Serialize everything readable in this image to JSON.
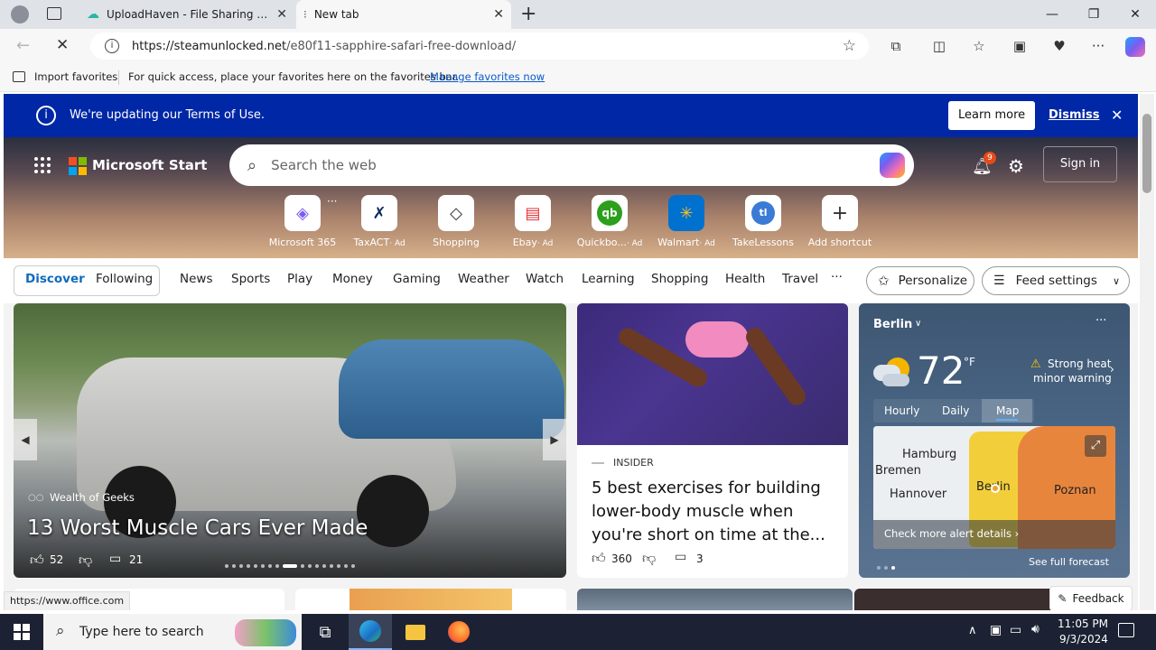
{
  "browser": {
    "tabs": [
      {
        "title": "UploadHaven - File Sharing Made Simple",
        "active": false
      },
      {
        "title": "New tab",
        "active": true
      }
    ],
    "url_domain": "https://steamunlocked.net",
    "url_path": "/e80f11-sapphire-safari-free-download/"
  },
  "favbar": {
    "import_label": "Import favorites",
    "hint": "For quick access, place your favorites here on the favorites bar.",
    "manage_link": "Manage favorites now"
  },
  "banner": {
    "text": "We're updating our Terms of Use.",
    "learn_more": "Learn more",
    "dismiss": "Dismiss"
  },
  "msn": {
    "brand": "Microsoft Start",
    "search_placeholder": "Search the web",
    "notif_count": "9",
    "sign_in": "Sign in",
    "shortcuts": [
      {
        "label": "Microsoft 365",
        "ad": "",
        "icon": "m365-icon",
        "color": "#7b5cf0"
      },
      {
        "label": "TaxACT",
        "ad": "· Ad",
        "icon": "taxact-icon",
        "color": "#0a2a5a"
      },
      {
        "label": "Shopping",
        "ad": "",
        "icon": "tag-icon",
        "color": "#333333"
      },
      {
        "label": "Ebay",
        "ad": "· Ad",
        "icon": "ebay-icon",
        "color": "#e53238"
      },
      {
        "label": "Quickbo...",
        "ad": "· Ad",
        "icon": "quickbooks-icon",
        "color": "#2ca01c"
      },
      {
        "label": "Walmart",
        "ad": "· Ad",
        "icon": "walmart-icon",
        "color": "#0071ce"
      },
      {
        "label": "TakeLessons",
        "ad": "",
        "icon": "takelessons-icon",
        "color": "#3a7bd5"
      },
      {
        "label": "Add shortcut",
        "ad": "",
        "icon": "plus-icon",
        "color": "#333333"
      }
    ]
  },
  "nav": {
    "discover": "Discover",
    "following": "Following",
    "items": [
      "News",
      "Sports",
      "Play",
      "Money",
      "Gaming",
      "Weather",
      "Watch",
      "Learning",
      "Shopping",
      "Health",
      "Travel"
    ],
    "more": "···",
    "personalize": "Personalize",
    "feed_settings": "Feed settings"
  },
  "hero_card": {
    "source": "Wealth of Geeks",
    "title": "13 Worst Muscle Cars Ever Made",
    "likes": "52",
    "comments": "21"
  },
  "news_card": {
    "source": "INSIDER",
    "title": "5 best exercises for building lower-body muscle when you're short on time at the...",
    "likes": "360",
    "comments": "3"
  },
  "weather": {
    "city": "Berlin",
    "temp": "72",
    "unit": "°F",
    "alert_line1": "Strong heat",
    "alert_line2": "minor warning",
    "tabs": [
      "Hourly",
      "Daily",
      "Map"
    ],
    "map_labels": {
      "a": "Hamburg",
      "b": "Bremen",
      "c": "Hannover",
      "d": "Berlin",
      "e": "Poznan"
    },
    "alert_link": "Check more alert details",
    "full_forecast": "See full forecast"
  },
  "status_url": "https://www.office.com",
  "feedback": "Feedback",
  "taskbar": {
    "search_placeholder": "Type here to search",
    "time": "11:05 PM",
    "date": "9/3/2024"
  }
}
